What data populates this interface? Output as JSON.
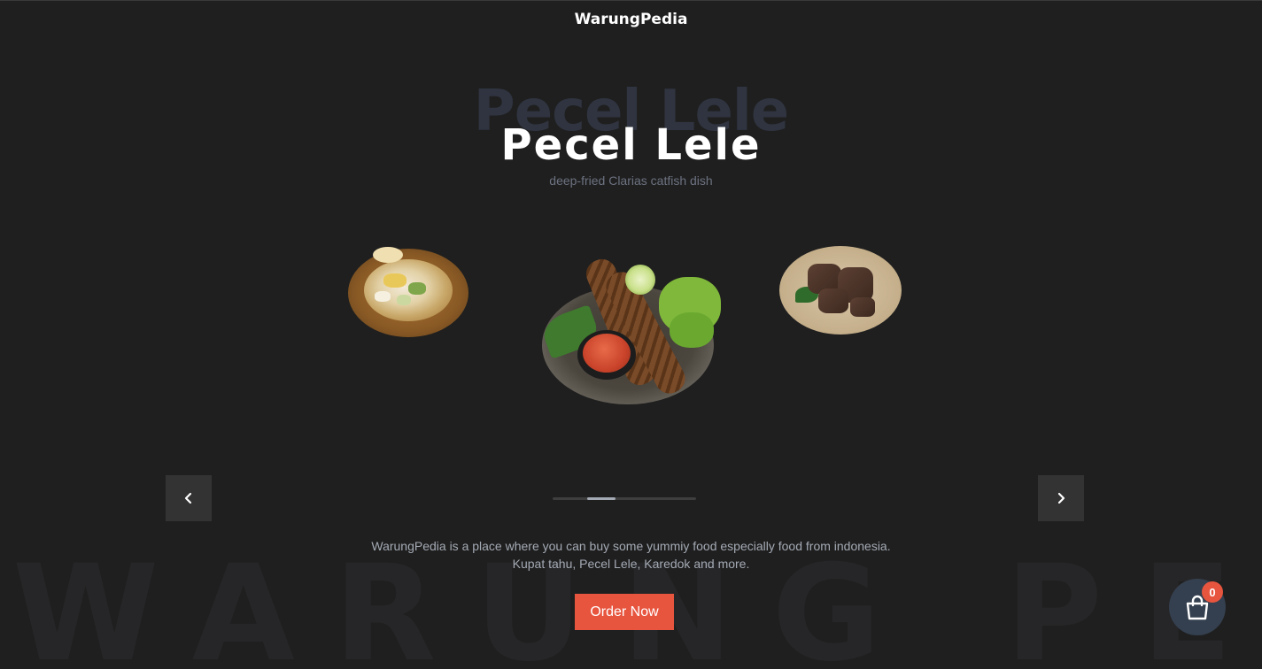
{
  "brand": "WarungPedia",
  "watermark": "WARUNG PEDIA",
  "hero": {
    "title_shadow": "Pecel Lele",
    "title": "Pecel Lele",
    "subtitle": "deep-fried Clarias catfish dish"
  },
  "carousel": {
    "slides": [
      "Kupat Tahu",
      "Pecel Lele",
      "Rendang"
    ],
    "active_index": 1,
    "progress_fraction": 0.2,
    "prev_icon": "chevron-left-icon",
    "next_icon": "chevron-right-icon"
  },
  "description": {
    "line1": "WarungPedia is a place where you can buy some yummiy food especially food from indonesia.",
    "line2": "Kupat tahu, Pecel Lele, Karedok and more."
  },
  "order_button": "Order Now",
  "cart": {
    "icon": "shopping-bag-icon",
    "count": "0"
  },
  "colors": {
    "background": "#1f1f1f",
    "accent": "#e8553f",
    "cart_bg": "#34404f",
    "muted_text": "#a4aab4"
  }
}
